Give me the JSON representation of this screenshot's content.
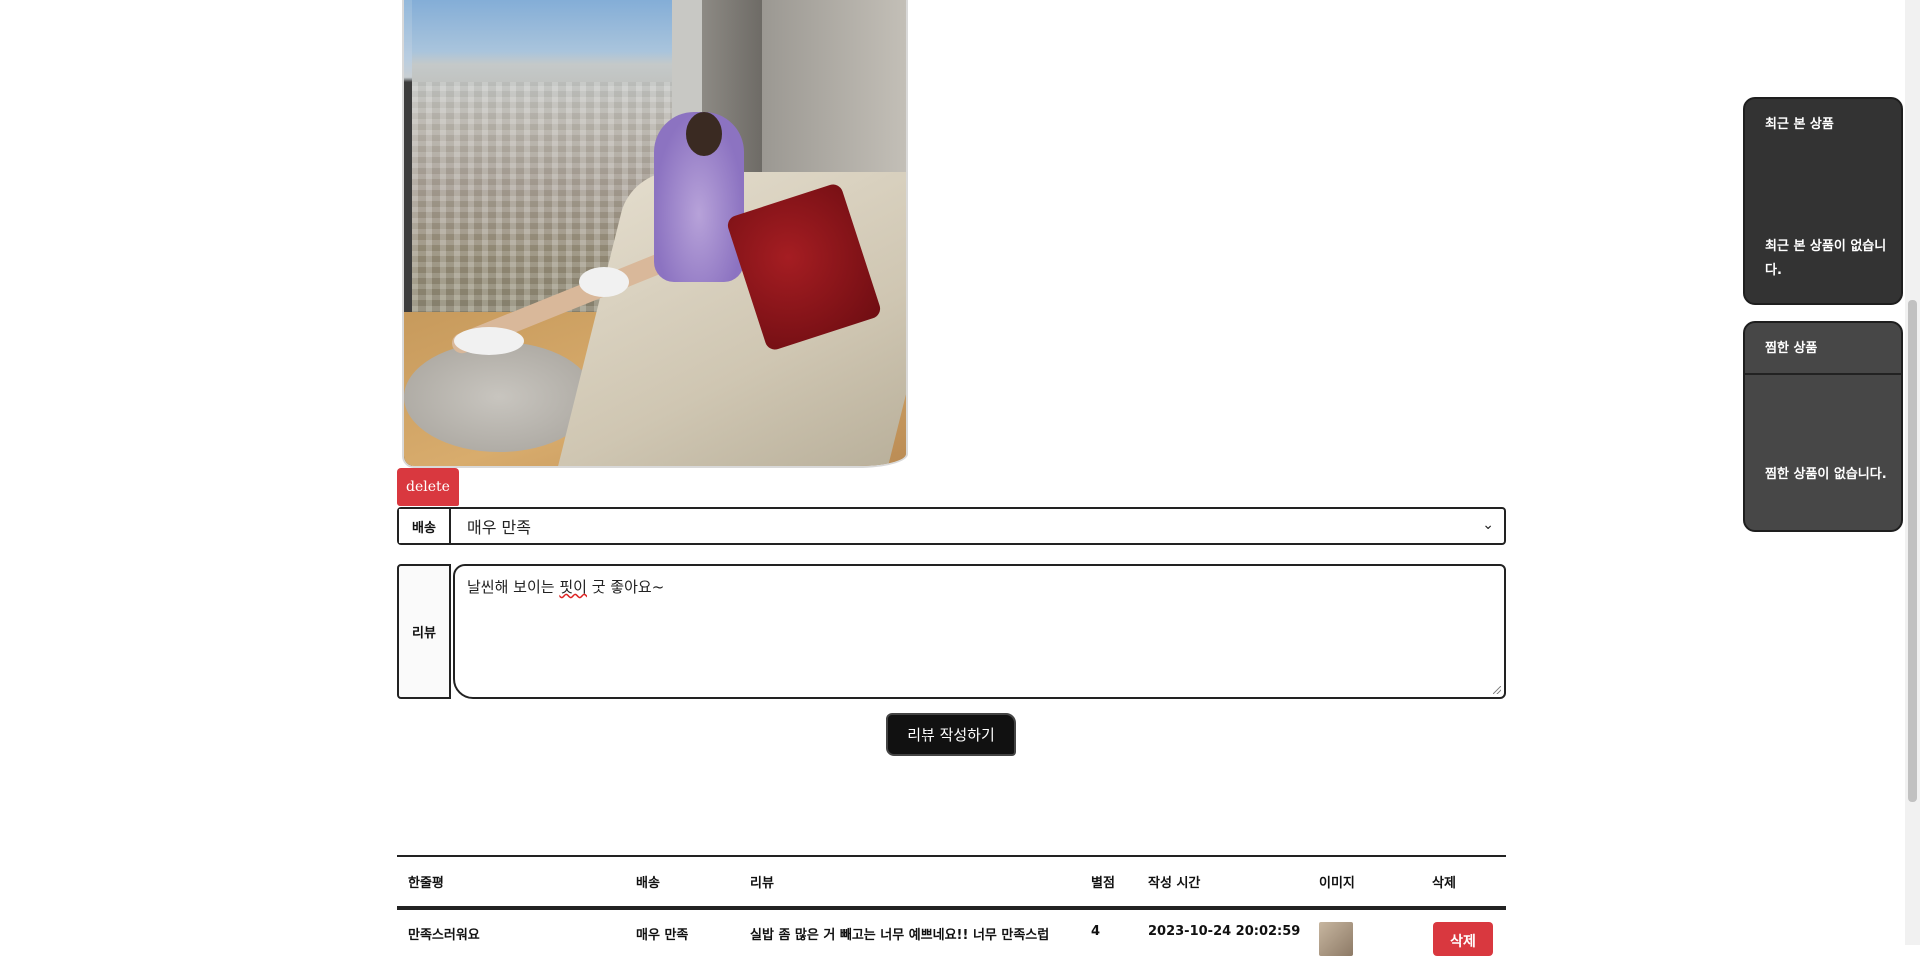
{
  "review_form": {
    "delete_label": "delete",
    "delivery_label": "배송",
    "delivery_selected": "매우 만족",
    "review_label": "리뷰",
    "review_text_before": "날씬해 보이는 ",
    "review_text_squiggle": "핏이",
    "review_text_after": " 굿 좋아요~",
    "submit_label": "리뷰 작성하기"
  },
  "table": {
    "headers": [
      "한줄평",
      "배송",
      "리뷰",
      "별점",
      "작성 시간",
      "이미지",
      "삭제"
    ],
    "rows": [
      {
        "summary": "만족스러워요",
        "delivery": "매우 만족",
        "review": "실밥 좀 많은 거 빼고는 너무 예쁘네요!! 너무 만족스럽",
        "rating": "4",
        "time": "2023-10-24 20:02:59",
        "delete_label": "삭제"
      }
    ]
  },
  "sidebar": {
    "recent_title": "최근 본 상품",
    "recent_empty": "최근 본 상품이 없습니다.",
    "fav_title": "찜한 상품",
    "fav_empty": "찜한 상품이 없습니다."
  },
  "colors": {
    "danger": "#d9383f",
    "dark": "#111111",
    "card_recent": "#333333",
    "card_fav": "#474747"
  }
}
